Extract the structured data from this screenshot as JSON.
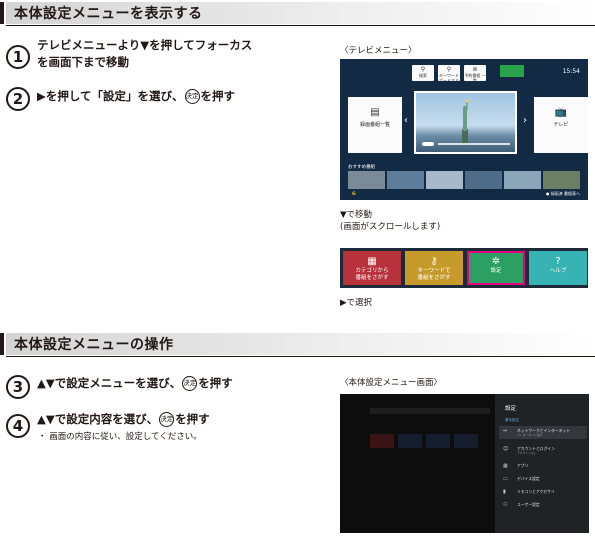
{
  "section1": {
    "title": "本体設定メニューを表示する",
    "steps": [
      {
        "num": "1",
        "line1": "テレビメニューより▼を押してフォーカス",
        "line2": "を画面下まで移動"
      },
      {
        "num": "2",
        "before": "▶を押して「設定」を選び、",
        "key": "決定",
        "after": "を押す"
      }
    ],
    "tv_menu_caption": "〈テレビメニュー〉",
    "tv_menu": {
      "top_icons": [
        "検索",
        "キーワード\nボードする",
        "予約番組\n一覧"
      ],
      "clock": "15:54",
      "left_card": "録画番組一覧",
      "right_card": "テレビ",
      "recommend": "おすすめ番組",
      "footer": "● 録画済 番組表へ"
    },
    "move_caption_1": "▼で移動",
    "move_caption_2": "(画面がスクロールします)",
    "tiles": [
      {
        "label": "カテゴリから\n番組をさがす",
        "icon": "grid-icon",
        "color": "#b8323c"
      },
      {
        "label": "キーワードで\n番組をさがす",
        "icon": "key-icon",
        "color": "#c79a2c"
      },
      {
        "label": "設定",
        "icon": "gear-icon",
        "color": "#2ba062"
      },
      {
        "label": "ヘルプ",
        "icon": "help-icon",
        "color": "#37b3b3"
      }
    ],
    "select_caption": "▶で選択"
  },
  "section2": {
    "title": "本体設定メニューの操作",
    "steps": [
      {
        "num": "3",
        "before": "▲▼で設定メニューを選び、",
        "key": "決定",
        "after": "を押す"
      },
      {
        "num": "4",
        "before": "▲▼で設定内容を選び、",
        "key": "決定",
        "after": "を押す"
      }
    ],
    "note": "・ 画面の内容に従い、設定してください。",
    "screen_caption": "〈本体設定メニュー画面〉",
    "settings_panel": {
      "title": "設定",
      "subtitle": "基本設定",
      "items": [
        {
          "label": "ネットワークとインターネット",
          "sub": "インターネット接続",
          "icon": "network-icon",
          "selected": true
        },
        {
          "label": "アカウントとログイン",
          "sub": "アカウントなし",
          "icon": "account-icon",
          "selected": false
        },
        {
          "label": "アプリ",
          "sub": "",
          "icon": "apps-icon",
          "selected": false
        },
        {
          "label": "デバイス設定",
          "sub": "",
          "icon": "device-icon",
          "selected": false
        },
        {
          "label": "リモコンとアクセサリ",
          "sub": "",
          "icon": "remote-icon",
          "selected": false
        },
        {
          "label": "ユーザー設定",
          "sub": "",
          "icon": "user-icon",
          "selected": false
        }
      ]
    }
  }
}
